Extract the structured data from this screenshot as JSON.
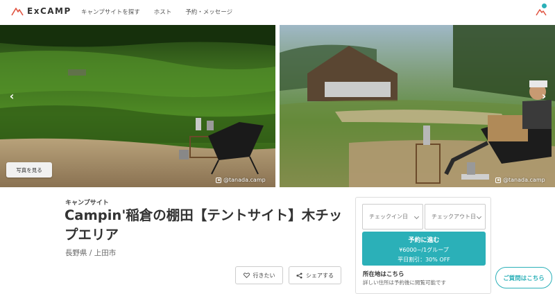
{
  "header": {
    "logo_text": "ExCAMP",
    "nav": [
      "キャンプサイトを探す",
      "ホスト",
      "予約・メッセージ"
    ]
  },
  "hero": {
    "see_photos_label": "写真を見る",
    "credit_left": "@tanada.camp",
    "credit_right": "@tanada.camp",
    "arrow_left_glyph": "‹",
    "arrow_right_glyph": "›"
  },
  "listing": {
    "category": "キャンプサイト",
    "title": "Campin'稲倉の棚田【テントサイト】木チップエリア",
    "location": "長野県 / 上田市",
    "want_label": "行きたい",
    "share_label": "シェアする"
  },
  "booking": {
    "checkin_placeholder": "チェックイン日",
    "checkout_placeholder": "チェックアウト日",
    "reserve_label": "予約に進む",
    "price_text": "¥6000~/1グループ",
    "weekday_discount": "平日割引：30% OFF",
    "location_label": "所在地はこちら",
    "location_note": "詳しい住所は予約後に閲覧可能です"
  },
  "question_label": "ご質問はこちら",
  "colors": {
    "accent": "#2bb0b8",
    "logo_red": "#e0523f"
  }
}
